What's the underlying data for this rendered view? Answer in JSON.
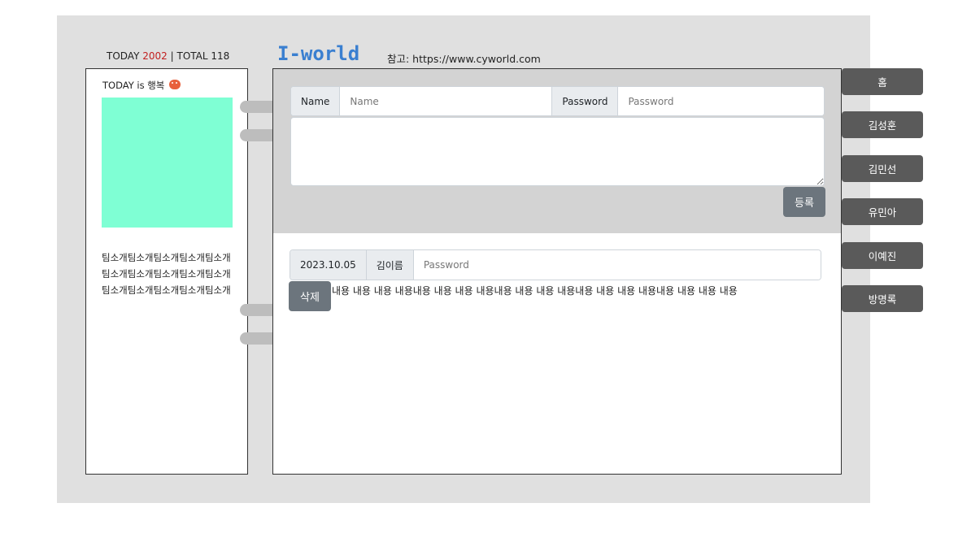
{
  "header": {
    "today_label": "TODAY",
    "today_count": "2002",
    "separator": "|",
    "total_label": "TOTAL",
    "total_count": "118",
    "logo": "I-world",
    "reference": "참고: https://www.cyworld.com"
  },
  "profile": {
    "mood": "TODAY is 행복",
    "photo_color": "#7fffd4",
    "intro": "팀소개팀소개팀소개팀소개팀소개팀소개팀소개팀소개팀소개팀소개팀소개팀소개팀소개팀소개팀소개"
  },
  "guestbook_form": {
    "name_label": "Name",
    "name_placeholder": "Name",
    "password_label": "Password",
    "password_placeholder": "Password",
    "content_value": "",
    "submit_label": "등록"
  },
  "entries": [
    {
      "date": "2023.10.05",
      "author": "김이름",
      "password_placeholder": "Password",
      "delete_label": "삭제",
      "content": "내용 내용 내용 내용내용 내용 내용 내용내용 내용 내용 내용내용 내용 내용 내용내용 내용 내용 내용"
    }
  ],
  "nav": {
    "items": [
      "홈",
      "김성훈",
      "김민선",
      "유민아",
      "이예진",
      "방명록"
    ]
  },
  "colors": {
    "frame_bg": "#e0e0e0",
    "write_area_bg": "#d3d3d3",
    "button_bg": "#6c757d",
    "tab_bg": "#5a5a5a",
    "logo_color": "#3a7fd0",
    "today_count_color": "#c21f1f"
  }
}
